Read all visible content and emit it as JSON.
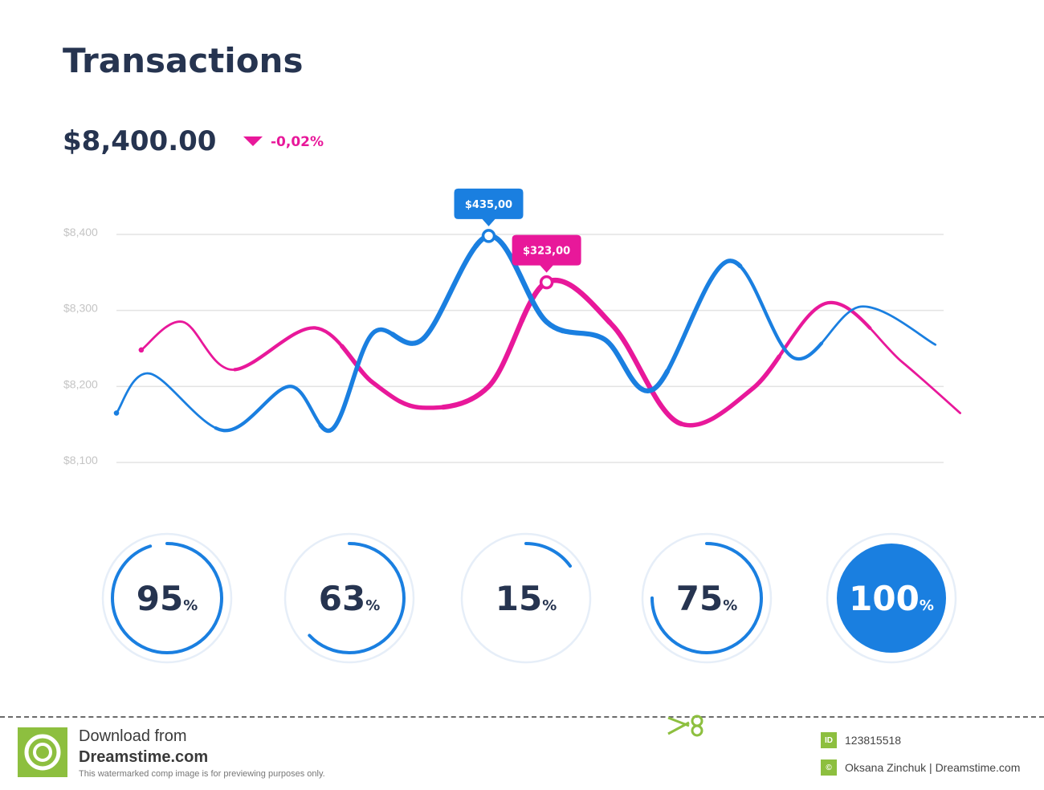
{
  "header": {
    "title": "Transactions",
    "amount": "$8,400.00",
    "change": "-0,02%"
  },
  "colors": {
    "blue": "#1a7fe0",
    "pink": "#e8189a",
    "navy": "#263450",
    "grid": "#e3e3e3",
    "axis_text": "#c4c4c4",
    "ring_track": "#e6eef8"
  },
  "chart_data": {
    "type": "line",
    "title": "Transactions",
    "ylim": [
      8100,
      8400
    ],
    "y_ticks": [
      "$8,400",
      "$8,300",
      "$8,200",
      "$8,100"
    ],
    "grid": true,
    "series": [
      {
        "color": "#1a7fe0",
        "points": [
          [
            0,
            8165
          ],
          [
            4,
            8217
          ],
          [
            13,
            8142
          ],
          [
            21,
            8200
          ],
          [
            26,
            8143
          ],
          [
            31,
            8270
          ],
          [
            37,
            8262
          ],
          [
            45,
            8398
          ],
          [
            52,
            8285
          ],
          [
            59,
            8262
          ],
          [
            65,
            8197
          ],
          [
            74,
            8365
          ],
          [
            82,
            8237
          ],
          [
            90,
            8305
          ],
          [
            99,
            8255
          ]
        ],
        "annotation": {
          "label": "$435,00",
          "x": 45,
          "y": 8398
        }
      },
      {
        "color": "#e8189a",
        "points": [
          [
            3,
            8248
          ],
          [
            8,
            8285
          ],
          [
            14,
            8222
          ],
          [
            24,
            8277
          ],
          [
            31,
            8205
          ],
          [
            37,
            8172
          ],
          [
            45,
            8200
          ],
          [
            52,
            8337
          ],
          [
            60,
            8280
          ],
          [
            68,
            8152
          ],
          [
            77,
            8198
          ],
          [
            86,
            8310
          ],
          [
            95,
            8232
          ],
          [
            102,
            8165
          ]
        ],
        "annotation": {
          "label": "$323,00",
          "x": 52,
          "y": 8337
        }
      }
    ]
  },
  "gauges": [
    {
      "value": 95,
      "label": "95",
      "unit": "%"
    },
    {
      "value": 63,
      "label": "63",
      "unit": "%"
    },
    {
      "value": 15,
      "label": "15",
      "unit": "%"
    },
    {
      "value": 75,
      "label": "75",
      "unit": "%"
    },
    {
      "value": 100,
      "label": "100",
      "unit": "%"
    }
  ],
  "watermark": {
    "line1": "Download from",
    "line2": "Dreamstime.com",
    "line3": "This watermarked comp image is for previewing purposes only.",
    "id_badge": "ID",
    "id": "123815518",
    "author": "Oksana Zinchuk | Dreamstime.com"
  }
}
